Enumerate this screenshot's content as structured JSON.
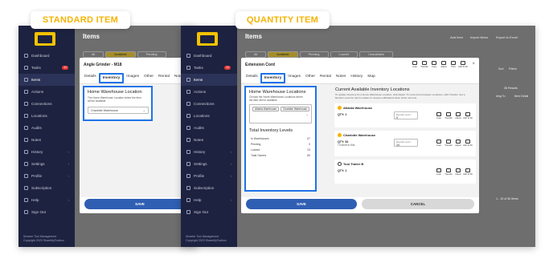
{
  "callouts": {
    "standard": "STANDARD ITEM",
    "quantity": "QUANTITY ITEM"
  },
  "app": {
    "page_title": "Items",
    "header_links": [
      "Add Item",
      "Import Items",
      "Export to Excel"
    ],
    "filter_tabs": [
      "All",
      "Available",
      "Pending",
      "Loaned",
      "Unavailable"
    ],
    "footer": [
      "Smarter Tool Management",
      "Copyright 2023 ShareMyToolbox"
    ],
    "results": "36 Results",
    "pager": "1 - 15 of 36 items",
    "side_texts": [
      "Sort",
      "Filters",
      "ding To",
      "Item Detail"
    ]
  },
  "nav": [
    {
      "label": "Dashboard",
      "icon": "dashboard-icon"
    },
    {
      "label": "Tasks",
      "icon": "tasks-icon",
      "badge": "11"
    },
    {
      "label": "Items",
      "icon": "items-icon",
      "active": true
    },
    {
      "label": "Actions",
      "icon": "actions-icon"
    },
    {
      "label": "Connections",
      "icon": "connections-icon"
    },
    {
      "label": "Locations",
      "icon": "locations-icon"
    },
    {
      "label": "Audits",
      "icon": "audits-icon"
    },
    {
      "label": "Notes",
      "icon": "notes-icon"
    },
    {
      "label": "History",
      "icon": "history-icon",
      "caret": true
    },
    {
      "label": "Settings",
      "icon": "settings-icon",
      "caret": true
    },
    {
      "label": "Profile",
      "icon": "profile-icon",
      "caret": true
    },
    {
      "label": "Subscription",
      "icon": "subscription-icon"
    },
    {
      "label": "Help",
      "icon": "help-icon",
      "caret": true
    },
    {
      "label": "Sign Out",
      "icon": "sign-out-icon"
    }
  ],
  "standard_modal": {
    "title": "Angle Grinder - M18",
    "tabs": [
      "Details",
      "Inventory",
      "Images",
      "Other",
      "Rental",
      "Notes"
    ],
    "section_title": "Home Warehouse Location",
    "section_hint": "The Home Warehouse Location where the item will be available.",
    "select_value": "Charlotte Warehouse",
    "save": "SAVE"
  },
  "quantity_modal": {
    "title": "Extension Cord",
    "tabs": [
      "Details",
      "Inventory",
      "Images",
      "Other",
      "Rental",
      "Notes",
      "History",
      "Map"
    ],
    "top_actions": [
      "Loan",
      "Transfer",
      "Copy",
      "Adjust",
      "Print",
      "Add To Kit"
    ],
    "home_title": "Home Warehouse Locations",
    "home_hint": "Choose the Home Warehouse Locations where the item will be available.",
    "chips": [
      "Atlanta Warehouse",
      "Charlotte Warehouse"
    ],
    "levels_title": "Total Inventory Levels",
    "levels": [
      {
        "label": "In Warehouses",
        "value": "57"
      },
      {
        "label": "Pending",
        "value": "0"
      },
      {
        "label": "Loaned",
        "value": "23"
      },
      {
        "label": "Total Owned",
        "value": "80"
      }
    ],
    "avail_title": "Current Available Inventory Locations",
    "avail_hint": "To update Inventory for a Home Warehouse Location, click Adjust. To move items between Locations, click Transfer. Set a Reorder Level for each Location to receive notifications when stock runs low.",
    "card_actions": [
      "Loan",
      "Transfer",
      "Adjust",
      "Add To Kit"
    ],
    "reorder_label": "Reorder Level",
    "locations": [
      {
        "name": "Atlanta Warehouse",
        "qty": "QTY: 1",
        "extra": "",
        "reorder": "0"
      },
      {
        "name": "Charlotte Warehouse",
        "qty": "QTY: 52",
        "extra": "+3 More in Kits",
        "reorder": "10"
      },
      {
        "name": "Tool Trailer B",
        "qty": "QTY: 1",
        "extra": "",
        "reorder": ""
      }
    ],
    "save": "SAVE",
    "cancel": "CANCEL"
  }
}
